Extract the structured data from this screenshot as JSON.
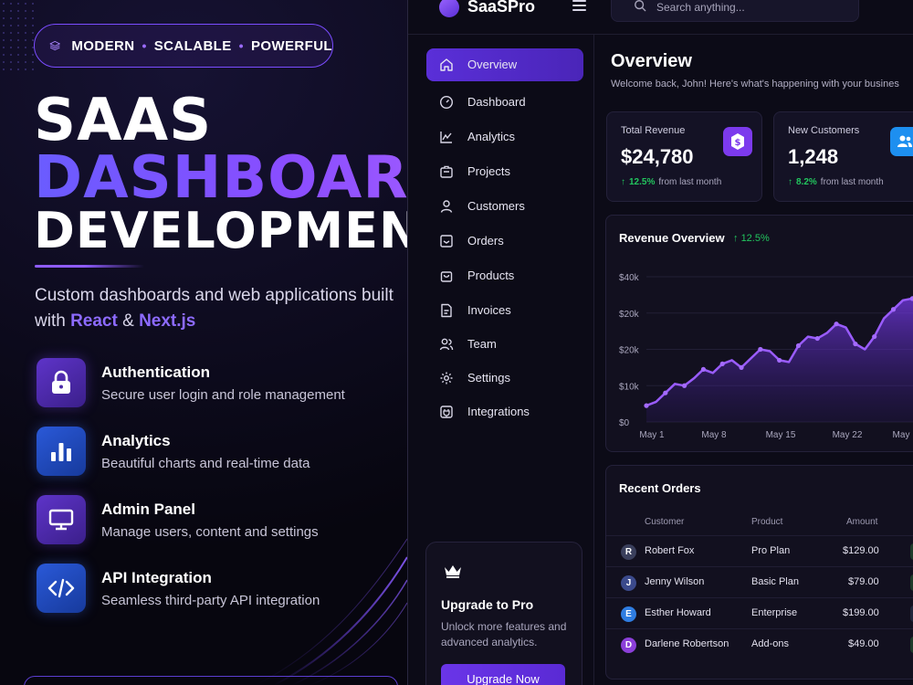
{
  "promo": {
    "pill": {
      "items": [
        "MODERN",
        "SCALABLE",
        "POWERFUL"
      ],
      "separator": "•"
    },
    "title_line1": "SAAS",
    "title_line2": "DASHBOARD",
    "title_line3": "DEVELOPMENT",
    "subtitle_part1": "Custom dashboards and web applications built with ",
    "subtitle_react": "React",
    "subtitle_amp": " & ",
    "subtitle_next": "Next.js",
    "features": [
      {
        "title": "Authentication",
        "desc": "Secure user login and role management",
        "icon": "lock-icon"
      },
      {
        "title": "Analytics",
        "desc": "Beautiful charts and real-time data",
        "icon": "bar-chart-icon"
      },
      {
        "title": "Admin Panel",
        "desc": "Manage users, content and settings",
        "icon": "monitor-icon"
      },
      {
        "title": "API Integration",
        "desc": "Seamless third-party API integration",
        "icon": "code-icon"
      }
    ]
  },
  "app": {
    "brand": "SaaSPro",
    "search_placeholder": "Search anything...",
    "nav": [
      {
        "label": "Overview",
        "icon": "home-icon",
        "active": true
      },
      {
        "label": "Dashboard",
        "icon": "gauge-icon"
      },
      {
        "label": "Analytics",
        "icon": "analytics-icon"
      },
      {
        "label": "Projects",
        "icon": "briefcase-icon"
      },
      {
        "label": "Customers",
        "icon": "user-icon"
      },
      {
        "label": "Orders",
        "icon": "inbox-icon"
      },
      {
        "label": "Products",
        "icon": "bag-icon"
      },
      {
        "label": "Invoices",
        "icon": "file-icon"
      },
      {
        "label": "Team",
        "icon": "team-icon"
      },
      {
        "label": "Settings",
        "icon": "gear-icon"
      },
      {
        "label": "Integrations",
        "icon": "plug-icon"
      }
    ],
    "upgrade": {
      "title": "Upgrade to Pro",
      "desc": "Unlock more features and advanced analytics.",
      "button": "Upgrade Now"
    },
    "page_title": "Overview",
    "welcome": "Welcome back, John! Here's what's happening with your busines",
    "stats": [
      {
        "label": "Total Revenue",
        "value": "$24,780",
        "delta": "12.5%",
        "delta_suffix": "from last month",
        "icon": "dollar-icon",
        "color": "#7c3aed"
      },
      {
        "label": "New Customers",
        "value": "1,248",
        "delta": "8.2%",
        "delta_suffix": "from last month",
        "icon": "users-icon",
        "color": "#1d8ff0"
      }
    ],
    "chart_title": "Revenue Overview",
    "chart_delta": "12.5%",
    "orders_title": "Recent Orders",
    "orders_columns": [
      "Customer",
      "Product",
      "Amount"
    ],
    "orders": [
      {
        "initial": "R",
        "name": "Robert Fox",
        "product": "Pro Plan",
        "amount": "$129.00",
        "color": "#3a3f5c"
      },
      {
        "initial": "J",
        "name": "Jenny Wilson",
        "product": "Basic Plan",
        "amount": "$79.00",
        "color": "#3b4a8c"
      },
      {
        "initial": "E",
        "name": "Esther Howard",
        "product": "Enterprise",
        "amount": "$199.00",
        "color": "#2f7de1"
      },
      {
        "initial": "D",
        "name": "Darlene Robertson",
        "product": "Add-ons",
        "amount": "$49.00",
        "color": "#8b3fd9"
      }
    ]
  },
  "chart_data": {
    "type": "area",
    "title": "Revenue Overview",
    "x_ticks": [
      "May 1",
      "May 8",
      "May 15",
      "May 22",
      "May"
    ],
    "y_ticks": [
      "$0",
      "$10k",
      "$20k",
      "$20k",
      "$40k"
    ],
    "ylim": [
      0,
      40000
    ],
    "x": [
      0,
      1,
      2,
      3,
      4,
      5,
      6,
      7,
      8,
      9,
      10,
      11,
      12,
      13,
      14,
      15,
      16,
      17,
      18,
      19,
      20,
      21,
      22,
      23,
      24,
      25,
      26,
      27,
      28,
      29,
      30
    ],
    "values": [
      4500,
      5500,
      8000,
      10500,
      10000,
      12000,
      14500,
      13500,
      16000,
      17000,
      15000,
      17500,
      20000,
      19500,
      17000,
      16500,
      21000,
      23500,
      23000,
      24500,
      27000,
      26000,
      21500,
      20000,
      23500,
      28500,
      31000,
      33500,
      34000,
      35500,
      34500
    ]
  }
}
